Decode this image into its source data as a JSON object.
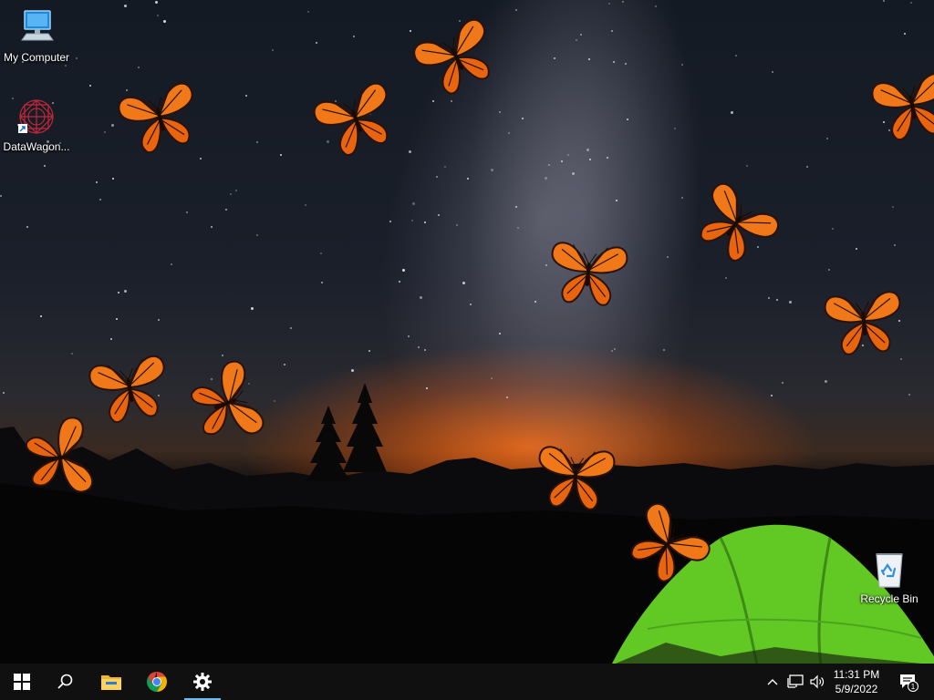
{
  "desktop": {
    "icons": [
      {
        "label": "My Computer",
        "icon": "computer-icon"
      },
      {
        "label": "DataWagon...",
        "icon": "datawagon-icon"
      },
      {
        "label": "Recycle Bin",
        "icon": "recycle-bin-icon"
      }
    ],
    "wallpaper": "night sky over mountains with green tent and monarch butterflies"
  },
  "taskbar": {
    "start": "start-icon",
    "search": "search-icon",
    "apps": [
      "file-explorer-icon",
      "chrome-icon",
      "settings-icon"
    ],
    "active_app": "settings-icon",
    "tray": {
      "time": "11:31 PM",
      "date": "5/9/2022",
      "notification_count": "1"
    }
  },
  "colors": {
    "taskbar_bg": "#101010",
    "butterfly_orange": "#f07818",
    "tent_green": "#6fd42a",
    "accent_blue": "#76b9ed"
  }
}
